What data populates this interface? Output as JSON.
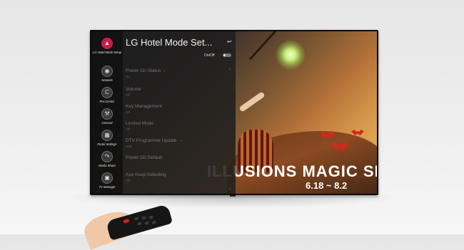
{
  "sidebar": {
    "items": [
      {
        "label": "LG Hotel Mode Setup",
        "icon": "hotel-icon",
        "active": true
      },
      {
        "label": "Network",
        "icon": "network-icon"
      },
      {
        "label": "Pro:Centric",
        "icon": "procentric-icon"
      },
      {
        "label": "General",
        "icon": "wrench-icon"
      },
      {
        "label": "Portal Settings",
        "icon": "portal-icon"
      },
      {
        "label": "Media Share",
        "icon": "share-icon"
      },
      {
        "label": "TV Manager",
        "icon": "tv-manager-icon"
      }
    ]
  },
  "panel": {
    "title": "LG Hotel Mode Set...",
    "onoff_label": "On/Off",
    "items": [
      {
        "label": "Power On Status",
        "sub": "On"
      },
      {
        "label": "Volume",
        "sub": "Off"
      },
      {
        "label": "Key Management",
        "sub": "Off"
      },
      {
        "label": "Limited Mode",
        "sub": "Off"
      },
      {
        "label": "DTV Programme Update",
        "sub": "Auto"
      },
      {
        "label": "Power On Default",
        "sub": ""
      },
      {
        "label": "Aux Keep Selecting",
        "sub": "Off"
      }
    ]
  },
  "background": {
    "show_title": "ILLUSIONS MAGIC SHOW",
    "show_dates": "6.18 ~ 8.2"
  },
  "colors": {
    "accent": "#c41f4a"
  }
}
